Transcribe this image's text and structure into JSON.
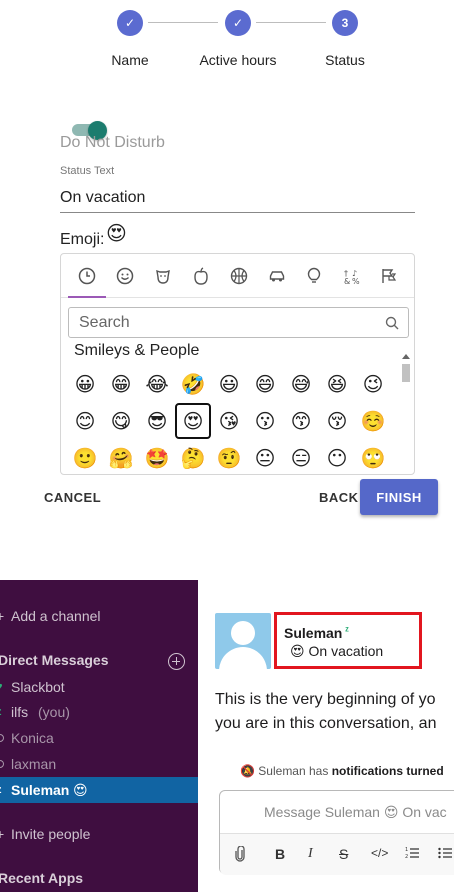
{
  "stepper": {
    "steps": [
      {
        "label": "Name",
        "marker": "✓"
      },
      {
        "label": "Active hours",
        "marker": "✓"
      },
      {
        "label": "Status",
        "marker": "3"
      }
    ],
    "accent": "#5b6bd0"
  },
  "form": {
    "dnd_label": "Do Not Disturb",
    "dnd_on": true,
    "status_caption": "Status Text",
    "status_value": "On vacation",
    "emoji_label": "Emoji:",
    "emoji_selected": "😍"
  },
  "picker": {
    "categories": [
      "clock-icon",
      "smiley-icon",
      "dog-icon",
      "apple-icon",
      "basketball-icon",
      "car-icon",
      "lightbulb-icon",
      "symbols-icon",
      "flag-icon"
    ],
    "search_placeholder": "Search",
    "category_title": "Smileys & People",
    "rows": [
      [
        "😀",
        "😁",
        "😂",
        "🤣",
        "😃",
        "😄",
        "😅",
        "😆",
        "😉"
      ],
      [
        "😊",
        "😋",
        "😎",
        "😍",
        "😘",
        "😗",
        "😙",
        "😚",
        "☺️"
      ],
      [
        "🙂",
        "🤗",
        "🤩",
        "🤔",
        "🤨",
        "😐",
        "😑",
        "😶",
        "🙄"
      ]
    ],
    "selected": "😍"
  },
  "actions": {
    "cancel": "CANCEL",
    "back": "BACK",
    "finish": "FINISH",
    "finish_color": "#5568c9"
  },
  "slack_sidebar": {
    "add_channel": "Add a channel",
    "dm_header": "Direct Messages",
    "dms": [
      {
        "name": "Slackbot",
        "suffix": "",
        "presence": "heart",
        "active": false
      },
      {
        "name": "ilfs",
        "suffix": "(you)",
        "presence": "away-zz",
        "active": false
      },
      {
        "name": "Konica",
        "suffix": "",
        "presence": "offline",
        "active": false
      },
      {
        "name": "laxman",
        "suffix": "",
        "presence": "offline",
        "active": false
      },
      {
        "name": "Suleman",
        "suffix": "😍",
        "presence": "away-zz",
        "active": true
      }
    ],
    "invite": "Invite people",
    "recent_apps": "Recent Apps",
    "bg_color": "#3f0e40",
    "active_color": "#1164a3"
  },
  "slack_main": {
    "user_name": "Suleman",
    "user_status_emoji": "😍",
    "user_status_text": "On vacation",
    "intro_line1": "This is the very beginning of yo",
    "intro_line2": "you are in this conversation, an",
    "notif_prefix": "Suleman has",
    "notif_bold": "notifications turned",
    "message_placeholder": "Message Suleman 😍 On vac",
    "toolbar": [
      "paperclip-icon",
      "bold-icon",
      "italic-icon",
      "strike-icon",
      "code-icon",
      "ordered-list-icon",
      "bullet-list-icon"
    ]
  }
}
